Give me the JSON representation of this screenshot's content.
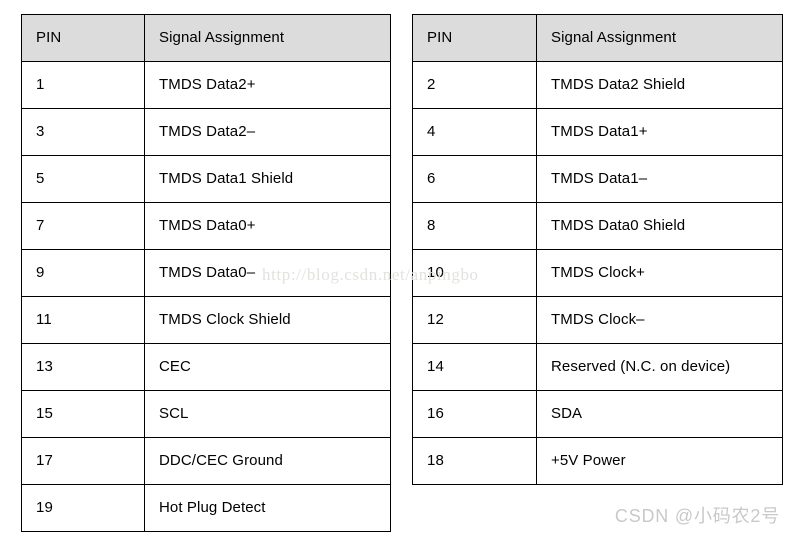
{
  "document": {
    "kind": "hdmi-pinout-tables",
    "background_color": "#ffffff",
    "header_background_color": "#dcdcdc",
    "border_color": "#000000",
    "text_color": "#000000"
  },
  "tables": {
    "left": {
      "name": "odd-pins-table",
      "columns": [
        "PIN",
        "Signal Assignment"
      ],
      "rows": [
        {
          "pin": "1",
          "signal": "TMDS Data2+"
        },
        {
          "pin": "3",
          "signal": "TMDS Data2–"
        },
        {
          "pin": "5",
          "signal": "TMDS Data1 Shield"
        },
        {
          "pin": "7",
          "signal": "TMDS Data0+"
        },
        {
          "pin": "9",
          "signal": "TMDS Data0–"
        },
        {
          "pin": "11",
          "signal": "TMDS Clock Shield"
        },
        {
          "pin": "13",
          "signal": "CEC"
        },
        {
          "pin": "15",
          "signal": "SCL"
        },
        {
          "pin": "17",
          "signal": "DDC/CEC Ground"
        },
        {
          "pin": "19",
          "signal": "Hot Plug Detect"
        }
      ]
    },
    "right": {
      "name": "even-pins-table",
      "columns": [
        "PIN",
        "Signal Assignment"
      ],
      "rows": [
        {
          "pin": "2",
          "signal": "TMDS Data2 Shield"
        },
        {
          "pin": "4",
          "signal": "TMDS Data1+"
        },
        {
          "pin": "6",
          "signal": "TMDS Data1–"
        },
        {
          "pin": "8",
          "signal": "TMDS Data0 Shield"
        },
        {
          "pin": "10",
          "signal": "TMDS Clock+"
        },
        {
          "pin": "12",
          "signal": "TMDS Clock–"
        },
        {
          "pin": "14",
          "signal": "Reserved (N.C. on device)"
        },
        {
          "pin": "16",
          "signal": "SDA"
        },
        {
          "pin": "18",
          "signal": "+5V Power"
        }
      ]
    }
  },
  "watermarks": {
    "url": "http://blog.csdn.net/anpingbo",
    "url_color": "#e3e2de",
    "attribution": "CSDN @小码农2号",
    "attribution_color": "#c9c9c9"
  }
}
